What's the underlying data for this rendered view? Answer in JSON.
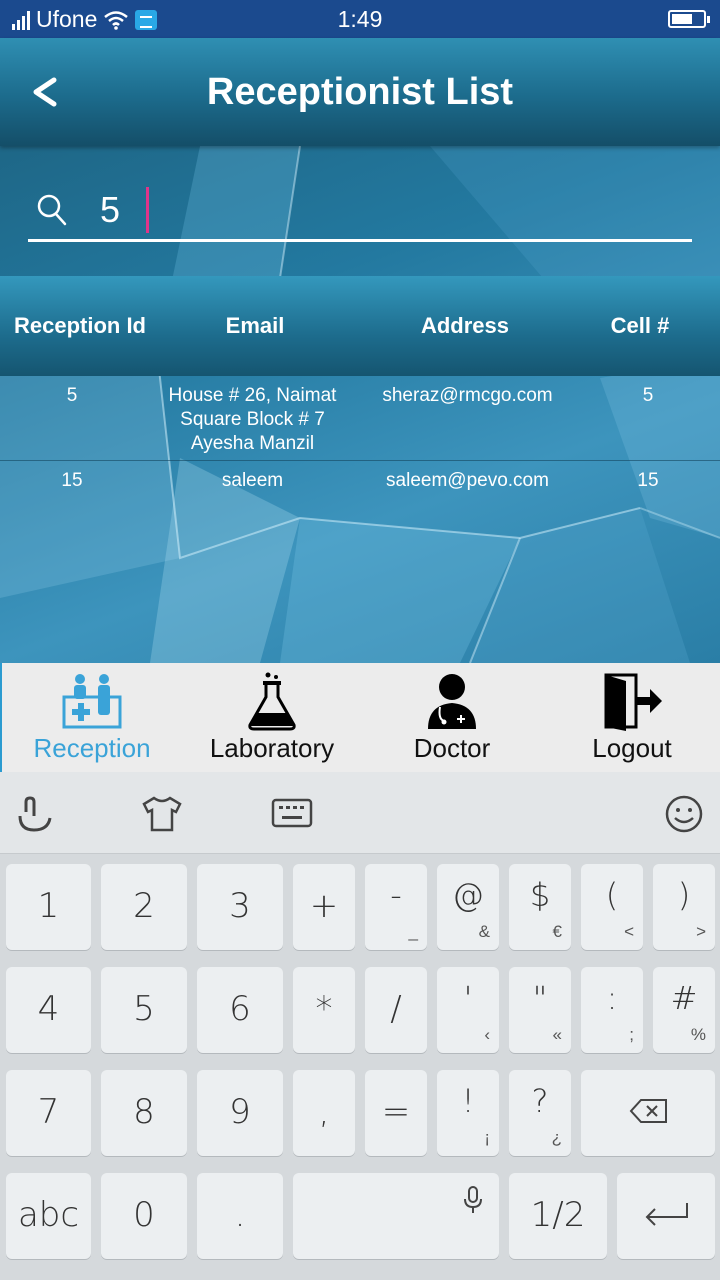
{
  "status_bar": {
    "carrier": "Ufone",
    "time": "1:49"
  },
  "header": {
    "title": "Receptionist List"
  },
  "search": {
    "value": "5",
    "placeholder": ""
  },
  "table": {
    "columns": [
      "Reception Id",
      "Email",
      "Address",
      "Cell #"
    ],
    "rows": [
      {
        "id": "5",
        "email": "House # 26, Naimat Square Block # 7 Ayesha Manzil",
        "address": "sheraz@rmcgo.com",
        "cell": "5"
      },
      {
        "id": "15",
        "email": "saleem",
        "address": "saleem@pevo.com",
        "cell": "15"
      }
    ]
  },
  "bottom_nav": {
    "items": [
      {
        "label": "Reception",
        "icon": "reception-icon",
        "active": true
      },
      {
        "label": "Laboratory",
        "icon": "flask-icon",
        "active": false
      },
      {
        "label": "Doctor",
        "icon": "doctor-icon",
        "active": false
      },
      {
        "label": "Logout",
        "icon": "logout-icon",
        "active": false
      }
    ],
    "active_color": "#3aa3d8"
  },
  "keyboard": {
    "toolbar": [
      "touch-gesture-icon",
      "shirt-theme-icon",
      "keyboard-icon",
      "emoji-icon"
    ],
    "row1": [
      {
        "main": "1"
      },
      {
        "main": "2"
      },
      {
        "main": "3"
      },
      {
        "main": "+"
      },
      {
        "main": "-",
        "alt": "_"
      },
      {
        "main": "@",
        "alt": "&"
      },
      {
        "main": "$",
        "alt": "€"
      },
      {
        "main": "(",
        "alt": "<"
      },
      {
        "main": ")",
        "alt": ">"
      }
    ],
    "row2": [
      {
        "main": "4"
      },
      {
        "main": "5"
      },
      {
        "main": "6"
      },
      {
        "main": "*"
      },
      {
        "main": "/"
      },
      {
        "main": "'",
        "alt": "‹"
      },
      {
        "main": "\"",
        "alt": "«"
      },
      {
        "main": ":",
        "alt": ";"
      },
      {
        "main": "#",
        "alt": "%"
      }
    ],
    "row3": [
      {
        "main": "7"
      },
      {
        "main": "8"
      },
      {
        "main": "9"
      },
      {
        "main": ","
      },
      {
        "main": "="
      },
      {
        "main": "!",
        "alt": "¡"
      },
      {
        "main": "?",
        "alt": "¿"
      }
    ],
    "row4": [
      {
        "main": "abc"
      },
      {
        "main": "0"
      },
      {
        "main": "."
      },
      {
        "main": "1/2"
      }
    ]
  }
}
